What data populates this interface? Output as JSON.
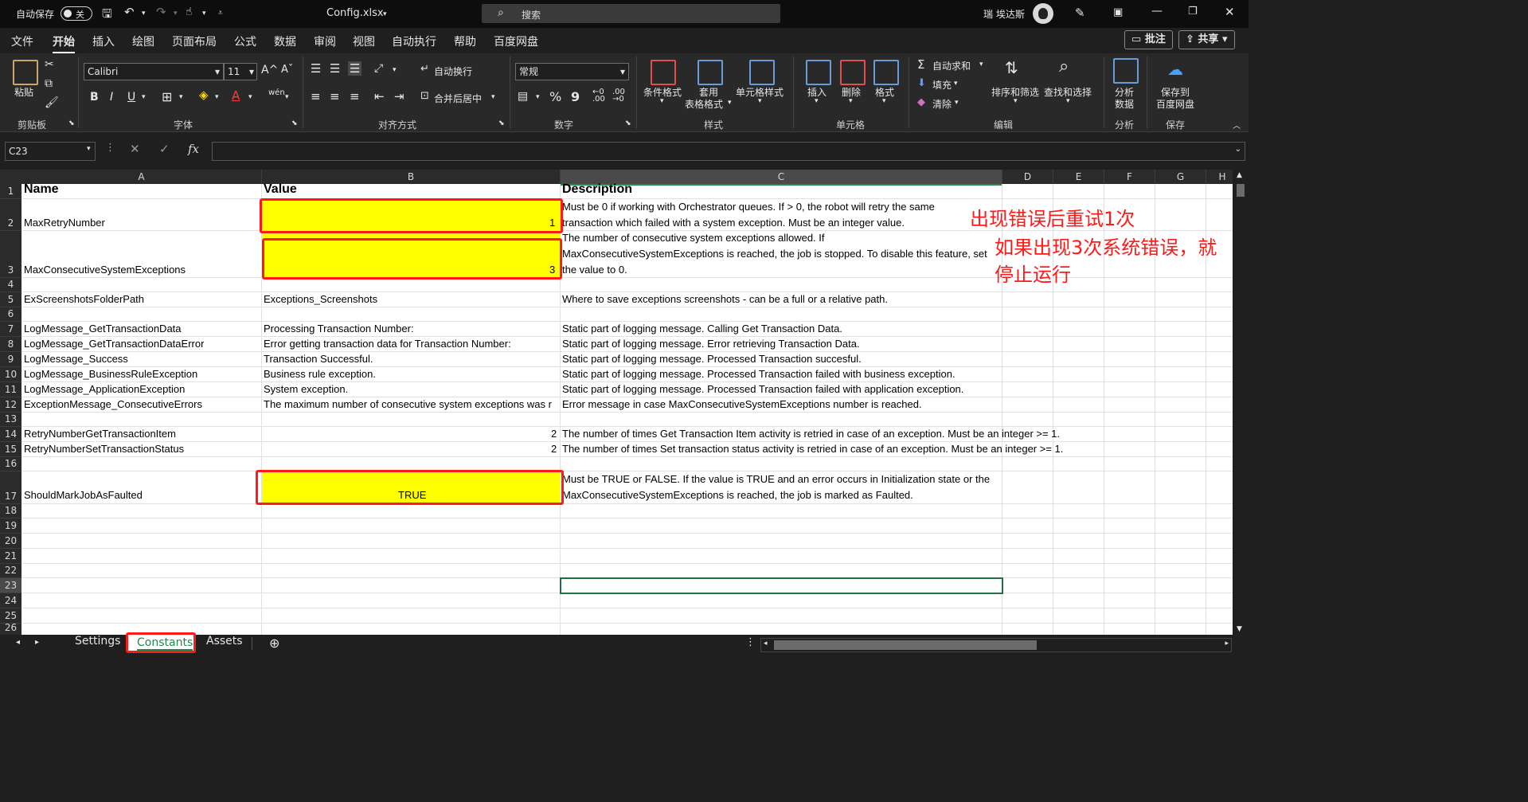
{
  "titlebar": {
    "autosave_label": "自动保存",
    "autosave_state": "关",
    "filename": "Config.xlsx",
    "search_placeholder": "搜索",
    "user_name": "瑞 埃达斯"
  },
  "menubar": {
    "items": [
      "文件",
      "开始",
      "插入",
      "绘图",
      "页面布局",
      "公式",
      "数据",
      "审阅",
      "视图",
      "自动执行",
      "帮助",
      "百度网盘"
    ],
    "active": "开始",
    "comment_button": "批注",
    "share_button": "共享"
  },
  "ribbon": {
    "clipboard": {
      "paste": "粘贴",
      "group": "剪贴板"
    },
    "font": {
      "name": "Calibri",
      "size": "11",
      "bold": "B",
      "italic": "I",
      "underline": "U",
      "group": "字体"
    },
    "alignment": {
      "wrap": "自动换行",
      "merge": "合并后居中",
      "group": "对齐方式"
    },
    "number": {
      "format": "常规",
      "percent": "%",
      "comma": "9",
      "group": "数字"
    },
    "styles": {
      "conditional": "条件格式",
      "table1": "套用",
      "table2": "表格格式",
      "cell_styles": "单元格样式",
      "group": "样式"
    },
    "cells": {
      "insert": "插入",
      "delete": "删除",
      "format": "格式",
      "group": "单元格"
    },
    "editing": {
      "autosum": "自动求和",
      "fill": "填充",
      "clear": "清除",
      "sort": "排序和筛选",
      "find": "查找和选择",
      "group": "编辑"
    },
    "analysis": {
      "analyze1": "分析",
      "analyze2": "数据",
      "group": "分析"
    },
    "save": {
      "save1": "保存到",
      "save2": "百度网盘",
      "group": "保存"
    }
  },
  "formula_bar": {
    "name_box": "C23",
    "fx": "fx",
    "content": ""
  },
  "sheet": {
    "columns": [
      "A",
      "B",
      "C",
      "D",
      "E",
      "F",
      "G",
      "H"
    ],
    "selected_column": "C",
    "selected_row": "23",
    "rows": [
      "1",
      "2",
      "3",
      "4",
      "5",
      "6",
      "7",
      "8",
      "9",
      "10",
      "11",
      "12",
      "13",
      "14",
      "15",
      "16",
      "17",
      "18",
      "19",
      "20",
      "21",
      "22",
      "23",
      "24",
      "25",
      "26"
    ],
    "header": {
      "name": "Name",
      "value": "Value",
      "description": "Description"
    },
    "cells": {
      "r2": {
        "name": "MaxRetryNumber",
        "value": "1",
        "desc1": "Must be 0 if working with Orchestrator queues. If > 0, the robot will retry the same",
        "desc2": "transaction which failed with a system exception. Must be an integer value."
      },
      "r3": {
        "name": "MaxConsecutiveSystemExceptions",
        "value": "3",
        "desc1": "The number of consecutive system exceptions allowed. If",
        "desc2": "MaxConsecutiveSystemExceptions is reached, the job is stopped. To disable this feature, set",
        "desc3": "the value to 0."
      },
      "r5": {
        "name": "ExScreenshotsFolderPath",
        "value": "Exceptions_Screenshots",
        "desc": "Where to save exceptions screenshots - can be a full or a relative path."
      },
      "r7": {
        "name": "LogMessage_GetTransactionData",
        "value": "Processing Transaction Number:",
        "desc": "Static part of logging message. Calling Get Transaction Data."
      },
      "r8": {
        "name": "LogMessage_GetTransactionDataError",
        "value": "Error getting transaction data for Transaction Number:",
        "desc": "Static part of logging message. Error retrieving Transaction Data."
      },
      "r9": {
        "name": "LogMessage_Success",
        "value": "Transaction Successful.",
        "desc": "Static part of logging message. Processed Transaction succesful."
      },
      "r10": {
        "name": "LogMessage_BusinessRuleException",
        "value": "Business rule exception.",
        "desc": "Static part of logging message. Processed Transaction failed with business exception."
      },
      "r11": {
        "name": "LogMessage_ApplicationException",
        "value": "System exception.",
        "desc": "Static part of logging message. Processed Transaction failed with application exception."
      },
      "r12": {
        "name": "ExceptionMessage_ConsecutiveErrors",
        "value": "The maximum number of consecutive system exceptions was r",
        "desc": "Error message in case MaxConsecutiveSystemExceptions number is reached."
      },
      "r14": {
        "name": "RetryNumberGetTransactionItem",
        "value": "2",
        "desc": "The number of times Get Transaction Item activity is retried in case of an exception. Must be an integer >= 1."
      },
      "r15": {
        "name": "RetryNumberSetTransactionStatus",
        "value": "2",
        "desc": "The number of times Set transaction status activity is retried in case of an exception. Must be an integer >= 1."
      },
      "r17": {
        "name": "ShouldMarkJobAsFaulted",
        "value": "TRUE",
        "desc1": "Must be TRUE or FALSE. If the value is TRUE and an error occurs in Initialization state or the",
        "desc2": "MaxConsecutiveSystemExceptions is reached, the job is marked as Faulted."
      }
    },
    "annotations": {
      "note1": "出现错误后重试1次",
      "note2a": "如果出现3次系统错误，就",
      "note2b": "停止运行"
    }
  },
  "tabs": {
    "items": [
      "Settings",
      "Constants",
      "Assets"
    ],
    "active": "Constants"
  }
}
